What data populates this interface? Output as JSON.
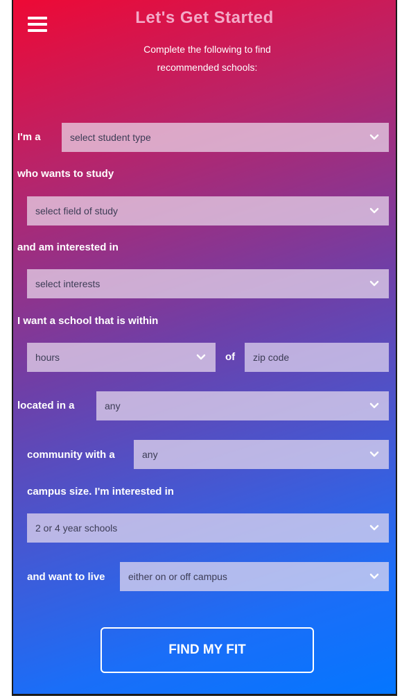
{
  "header": {
    "title": "Let's Get Started",
    "subtitle_line1": "Complete the following to find",
    "subtitle_line2": "recommended schools:"
  },
  "form": {
    "student_type": {
      "label": "I'm a",
      "value": "select student type"
    },
    "field_of_study": {
      "label": "who wants to study",
      "value": "select field of study"
    },
    "interests": {
      "label": "and am interested in",
      "value": "select interests"
    },
    "distance": {
      "label": "I want a school that is within",
      "hours_value": "hours",
      "of_label": "of",
      "zip_placeholder": "zip code"
    },
    "location": {
      "label": "located in a",
      "value": "any"
    },
    "community": {
      "label": "community with a",
      "value": "any"
    },
    "school_type": {
      "label": "campus size. I'm interested in",
      "value": "2 or 4 year schools"
    },
    "housing": {
      "label": "and want to live",
      "value": "either on or off campus"
    }
  },
  "submit": {
    "label": "FIND MY FIT"
  },
  "icons": {
    "menu": "hamburger-menu-icon",
    "dropdown": "chevron-down-icon"
  }
}
